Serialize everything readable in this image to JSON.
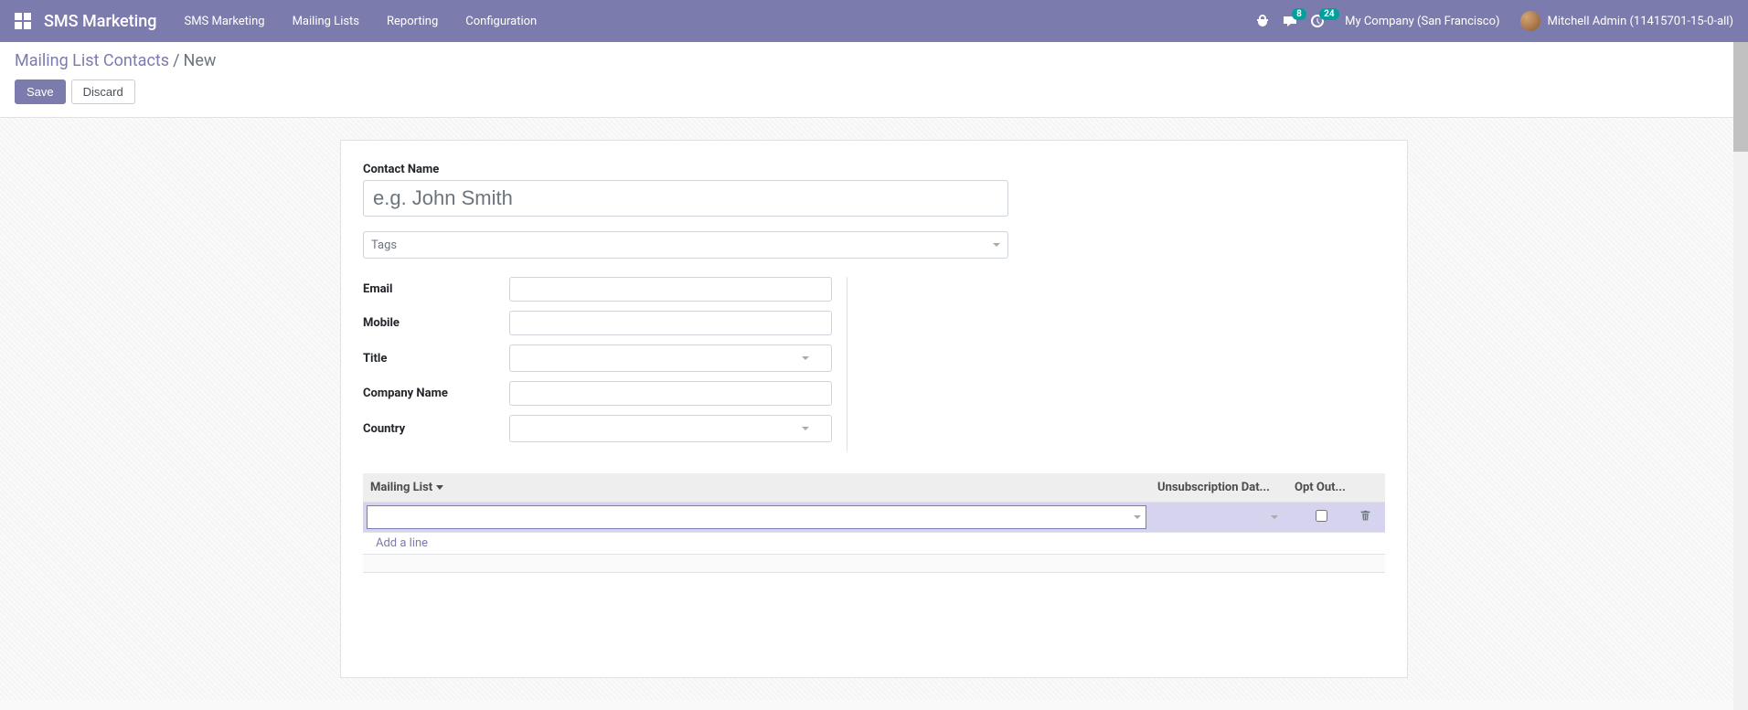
{
  "navbar": {
    "brand": "SMS Marketing",
    "menu": [
      "SMS Marketing",
      "Mailing Lists",
      "Reporting",
      "Configuration"
    ],
    "messages_badge": "8",
    "activities_badge": "24",
    "company": "My Company (San Francisco)",
    "user": "Mitchell Admin (11415701-15-0-all)"
  },
  "breadcrumb": {
    "parent": "Mailing List Contacts",
    "current": "New"
  },
  "buttons": {
    "save": "Save",
    "discard": "Discard"
  },
  "form": {
    "contact_name_label": "Contact Name",
    "contact_name_placeholder": "e.g. John Smith",
    "tags_placeholder": "Tags",
    "fields": {
      "email": "Email",
      "mobile": "Mobile",
      "title": "Title",
      "company_name": "Company Name",
      "country": "Country"
    }
  },
  "table": {
    "headers": {
      "mailing_list": "Mailing List",
      "unsub_date": "Unsubscription Dat...",
      "opt_out": "Opt Out..."
    },
    "add_line": "Add a line"
  }
}
